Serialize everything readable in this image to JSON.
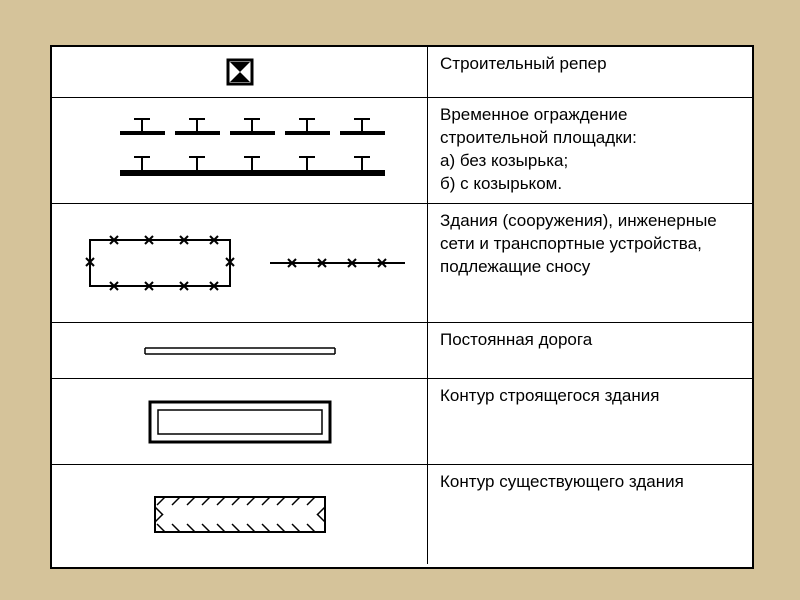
{
  "rows": [
    {
      "id": "reper",
      "label": "Строительный репер"
    },
    {
      "id": "fence",
      "label": "Временное ограждение строительной площадки:\nа) без козырька;\nб) с козырьком."
    },
    {
      "id": "demolish",
      "label": "Здания (сооружения), инженерные сети и транспортные устройства, подлежащие сносу"
    },
    {
      "id": "road",
      "label": "Постоянная дорога"
    },
    {
      "id": "construction",
      "label": "Контур строящегося здания"
    },
    {
      "id": "existing",
      "label": "Контур существующего здания"
    }
  ]
}
